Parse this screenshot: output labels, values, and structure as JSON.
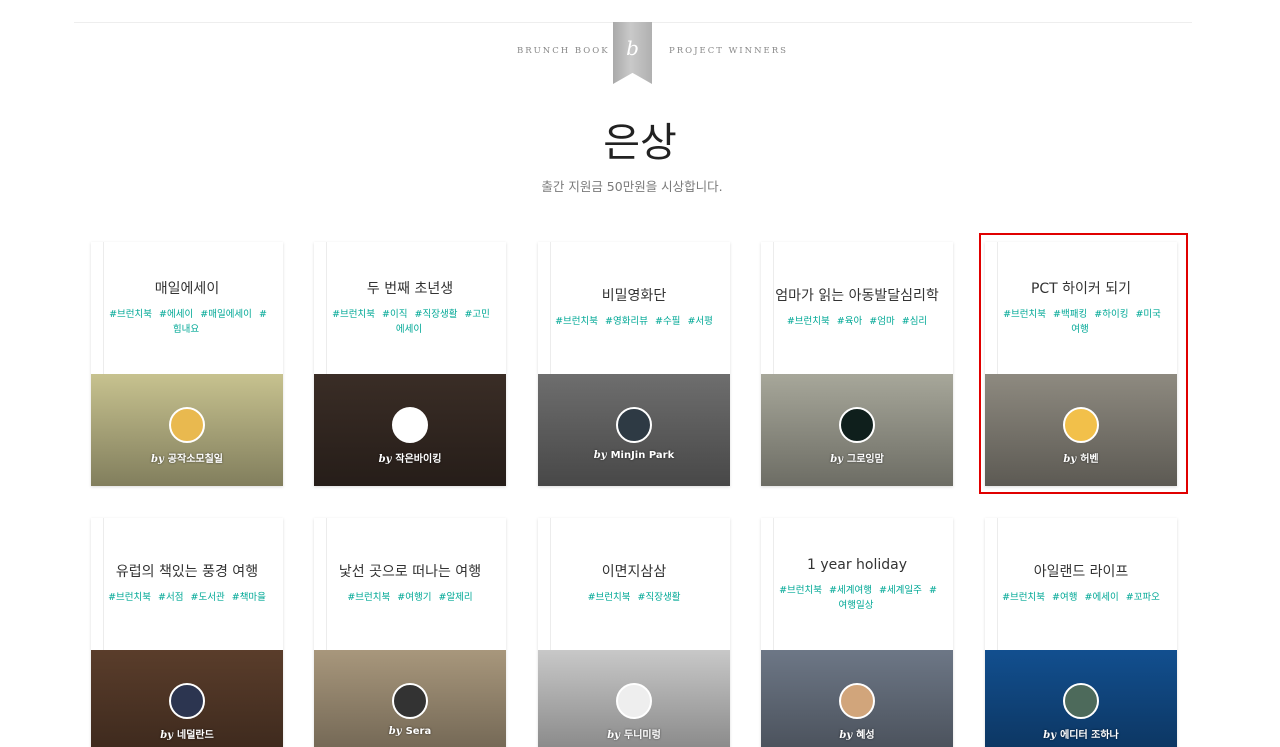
{
  "header": {
    "left": "BRUNCH BOOK",
    "right": "PROJECT WINNERS",
    "ribbon_letter": "b"
  },
  "page": {
    "title": "은상",
    "subtitle": "출간 지원금 50만원을 시상합니다."
  },
  "cards": [
    {
      "title": "매일에세이",
      "tags": [
        "#브런치북",
        "#에세이",
        "#매일에세이",
        "#힘내요"
      ],
      "author": "공작소모칠일",
      "cover_color": "#c7c28f",
      "avatar_color": "#e9b94f"
    },
    {
      "title": "두 번째 초년생",
      "tags": [
        "#브런치북",
        "#이직",
        "#직장생활",
        "#고민에세이"
      ],
      "author": "작은바이킹",
      "cover_color": "#3a2d26",
      "avatar_color": "#ffffff"
    },
    {
      "title": "비밀영화단",
      "tags": [
        "#브런치북",
        "#영화리뷰",
        "#수필",
        "#서평"
      ],
      "author": "MinJin Park",
      "cover_color": "#6e6e6e",
      "avatar_color": "#2e3a44"
    },
    {
      "title": "엄마가 읽는 아동발달심리학",
      "tags": [
        "#브런치북",
        "#육아",
        "#엄마",
        "#심리"
      ],
      "author": "그로잉맘",
      "cover_color": "#a7a79a",
      "avatar_color": "#0f1f1c"
    },
    {
      "title": "PCT 하이커 되기",
      "tags": [
        "#브런치북",
        "#백패킹",
        "#하이킹",
        "#미국여행"
      ],
      "author": "허벤",
      "cover_color": "#8e8a80",
      "avatar_color": "#f2c04a"
    },
    {
      "title": "유럽의 책있는 풍경 여행",
      "tags": [
        "#브런치북",
        "#서점",
        "#도서관",
        "#책마을"
      ],
      "author": "네덜란드",
      "cover_color": "#5a3d2b",
      "avatar_color": "#2c3550"
    },
    {
      "title": "낯선 곳으로 떠나는 여행",
      "tags": [
        "#브런치북",
        "#여행기",
        "#알제리"
      ],
      "author": "Sera",
      "cover_color": "#a8977c",
      "avatar_color": "#333333"
    },
    {
      "title": "이면지삼삼",
      "tags": [
        "#브런치북",
        "#직장생활"
      ],
      "author": "두니미렁",
      "cover_color": "#c8c8c8",
      "avatar_color": "#eeeeee"
    },
    {
      "title": "1 year holiday",
      "tags": [
        "#브런치북",
        "#세계여행",
        "#세계일주",
        "#여행일상"
      ],
      "author": "혜성",
      "cover_color": "#6d7786",
      "avatar_color": "#d1a57b"
    },
    {
      "title": "아일랜드 라이프",
      "tags": [
        "#브런치북",
        "#여행",
        "#에세이",
        "#꼬파오"
      ],
      "author": "에디터 조하나",
      "cover_color": "#124f8f",
      "avatar_color": "#4d6a5b"
    }
  ]
}
